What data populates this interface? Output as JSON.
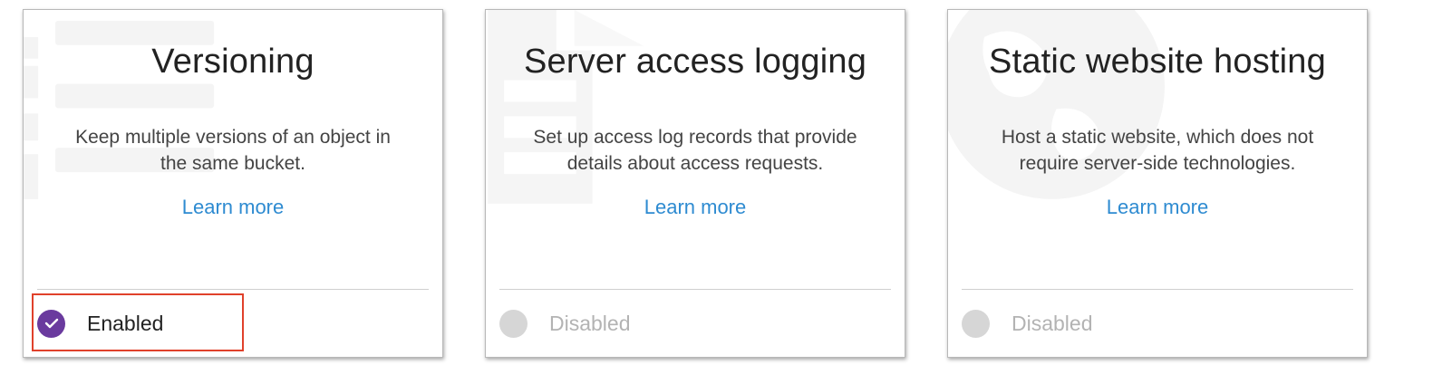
{
  "cards": [
    {
      "title": "Versioning",
      "description": "Keep multiple versions of an object in the same bucket.",
      "link": "Learn more",
      "status": "Enabled",
      "enabled": true
    },
    {
      "title": "Server access logging",
      "description": "Set up access log records that provide details about access requests.",
      "link": "Learn more",
      "status": "Disabled",
      "enabled": false
    },
    {
      "title": "Static website hosting",
      "description": "Host a static website, which does not require server-side technologies.",
      "link": "Learn more",
      "status": "Disabled",
      "enabled": false
    }
  ],
  "icons": {
    "enabled_status": "check-circle-icon",
    "disabled_status": "empty-circle-icon"
  },
  "colors": {
    "link": "#2e8bd1",
    "enabled_badge": "#6a3a9e",
    "disabled_badge": "#d6d6d6",
    "annotation_box": "#e0412b"
  }
}
